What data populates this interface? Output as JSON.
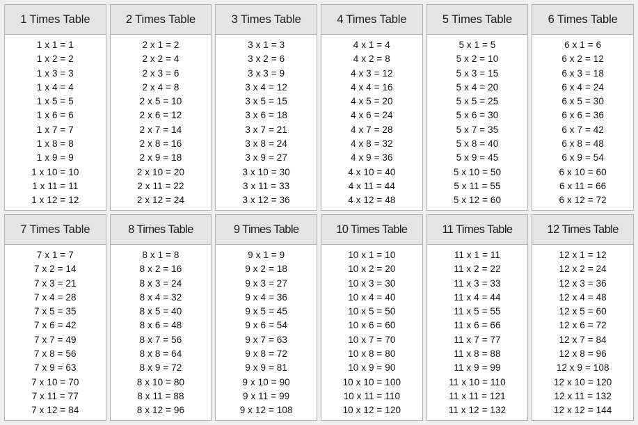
{
  "page": {
    "title": "Times Tables 1 to 12",
    "background_color": "#efefef",
    "card_background": "#ffffff",
    "card_border_color": "#b0b0b0",
    "header_background": "#e4e4e4",
    "text_color": "#111111",
    "columns": 6,
    "rows": 2
  },
  "tables": [
    {
      "id": "times-table-1",
      "factor": 1,
      "header": "1 Times Table",
      "tight_header": false,
      "rows": [
        "1 x 1 = 1",
        "1 x 2 = 2",
        "1 x 3 = 3",
        "1 x 4 = 4",
        "1 x 5 = 5",
        "1 x 6 = 6",
        "1 x 7 = 7",
        "1 x 8 = 8",
        "1 x 9 = 9",
        "1 x 10 = 10",
        "1 x 11 = 11",
        "1 x 12 = 12"
      ]
    },
    {
      "id": "times-table-2",
      "factor": 2,
      "header": "2 Times Table",
      "tight_header": false,
      "rows": [
        "2 x 1 = 2",
        "2 x 2 = 4",
        "2 x 3 = 6",
        "2 x 4 = 8",
        "2 x 5 = 10",
        "2 x 6 = 12",
        "2 x 7 = 14",
        "2 x 8 = 16",
        "2 x 9 = 18",
        "2 x 10 = 20",
        "2 x 11 = 22",
        "2 x 12 = 24"
      ]
    },
    {
      "id": "times-table-3",
      "factor": 3,
      "header": "3 Times Table",
      "tight_header": false,
      "rows": [
        "3 x 1 = 3",
        "3 x 2 = 6",
        "3 x 3 = 9",
        "3 x 4 = 12",
        "3 x 5 = 15",
        "3 x 6 = 18",
        "3 x 7 = 21",
        "3 x 8 = 24",
        "3 x 9 = 27",
        "3 x 10 = 30",
        "3 x 11 = 33",
        "3 x 12 = 36"
      ]
    },
    {
      "id": "times-table-4",
      "factor": 4,
      "header": "4 Times Table",
      "tight_header": false,
      "rows": [
        "4 x 1 = 4",
        "4 x 2 = 8",
        "4 x 3 = 12",
        "4 x 4 = 16",
        "4 x 5 = 20",
        "4 x 6 = 24",
        "4 x 7 = 28",
        "4 x 8 = 32",
        "4 x 9 = 36",
        "4 x 10 = 40",
        "4 x 11 = 44",
        "4 x 12 = 48"
      ]
    },
    {
      "id": "times-table-5",
      "factor": 5,
      "header": "5 Times Table",
      "tight_header": false,
      "rows": [
        "5 x 1 = 5",
        "5 x 2 = 10",
        "5 x 3 = 15",
        "5 x 4 = 20",
        "5 x 5 = 25",
        "5 x 6 = 30",
        "5 x 7 = 35",
        "5 x 8 = 40",
        "5 x 9 = 45",
        "5 x 10 = 50",
        "5 x 11 = 55",
        "5 x 12 = 60"
      ]
    },
    {
      "id": "times-table-6",
      "factor": 6,
      "header": "6 Times Table",
      "tight_header": false,
      "rows": [
        "6 x 1 = 6",
        "6 x 2 = 12",
        "6 x 3 = 18",
        "6 x 4 = 24",
        "6 x 5 = 30",
        "6 x 6 = 36",
        "6 x 7 = 42",
        "6 x 8 = 48",
        "6 x 9 = 54",
        "6 x 10 = 60",
        "6 x 11 = 66",
        "6 x 12 = 72"
      ]
    },
    {
      "id": "times-table-7",
      "factor": 7,
      "header": "7 Times Table",
      "tight_header": false,
      "rows": [
        "7 x 1 = 7",
        "7 x 2 = 14",
        "7 x 3 = 21",
        "7 x 4 = 28",
        "7 x 5 = 35",
        "7 x 6 = 42",
        "7 x 7 = 49",
        "7 x 8 = 56",
        "7 x 9 = 63",
        "7 x 10 = 70",
        "7 x 11 = 77",
        "7 x 12 = 84"
      ]
    },
    {
      "id": "times-table-8",
      "factor": 8,
      "header": "8 Times Table",
      "tight_header": true,
      "rows": [
        "8 x 1 = 8",
        "8 x 2 = 16",
        "8 x 3 = 24",
        "8 x 4 = 32",
        "8 x 5 = 40",
        "8 x 6 = 48",
        "8 x 7 = 56",
        "8 x 8 = 64",
        "8 x 9 = 72",
        "8 x 10 = 80",
        "8 x 11 = 88",
        "8 x 12 = 96"
      ]
    },
    {
      "id": "times-table-9",
      "factor": 9,
      "header": "9 Times Table",
      "tight_header": true,
      "rows": [
        "9 x 1 = 9",
        "9 x 2 = 18",
        "9 x 3 = 27",
        "9 x 4 = 36",
        "9 x 5 = 45",
        "9 x 6 = 54",
        "9 x 7 = 63",
        "9 x 8 = 72",
        "9 x 9 = 81",
        "9 x 10 = 90",
        "9 x 11 = 99",
        "9 x 12 = 108"
      ]
    },
    {
      "id": "times-table-10",
      "factor": 10,
      "header": "10 Times Table",
      "tight_header": true,
      "rows": [
        "10 x 1 = 10",
        "10 x 2 = 20",
        "10 x 3 = 30",
        "10 x 4 = 40",
        "10 x 5 = 50",
        "10 x 6 = 60",
        "10 x 7 = 70",
        "10 x 8 = 80",
        "10 x 9 = 90",
        "10 x 10 = 100",
        "10 x 11 = 110",
        "10 x 12 = 120"
      ]
    },
    {
      "id": "times-table-11",
      "factor": 11,
      "header": "11 Times Table",
      "tight_header": true,
      "rows": [
        "11 x 1 = 11",
        "11 x 2 = 22",
        "11 x 3 = 33",
        "11 x 4 = 44",
        "11 x 5 = 55",
        "11 x 6 = 66",
        "11 x 7 = 77",
        "11 x 8 = 88",
        "11 x 9 = 99",
        "11 x 10 = 110",
        "11 x 11 = 121",
        "11 x 12 = 132"
      ]
    },
    {
      "id": "times-table-12",
      "factor": 12,
      "header": "12 Times Table",
      "tight_header": true,
      "rows": [
        "12 x 1 = 12",
        "12 x 2 = 24",
        "12 x 3 = 36",
        "12 x 4 = 48",
        "12 x 5 = 60",
        "12 x 6 = 72",
        "12 x 7 = 84",
        "12 x 8 = 96",
        "12 x 9 = 108",
        "12 x 10 = 120",
        "12 x 11 = 132",
        "12 x 12 = 144"
      ]
    }
  ]
}
